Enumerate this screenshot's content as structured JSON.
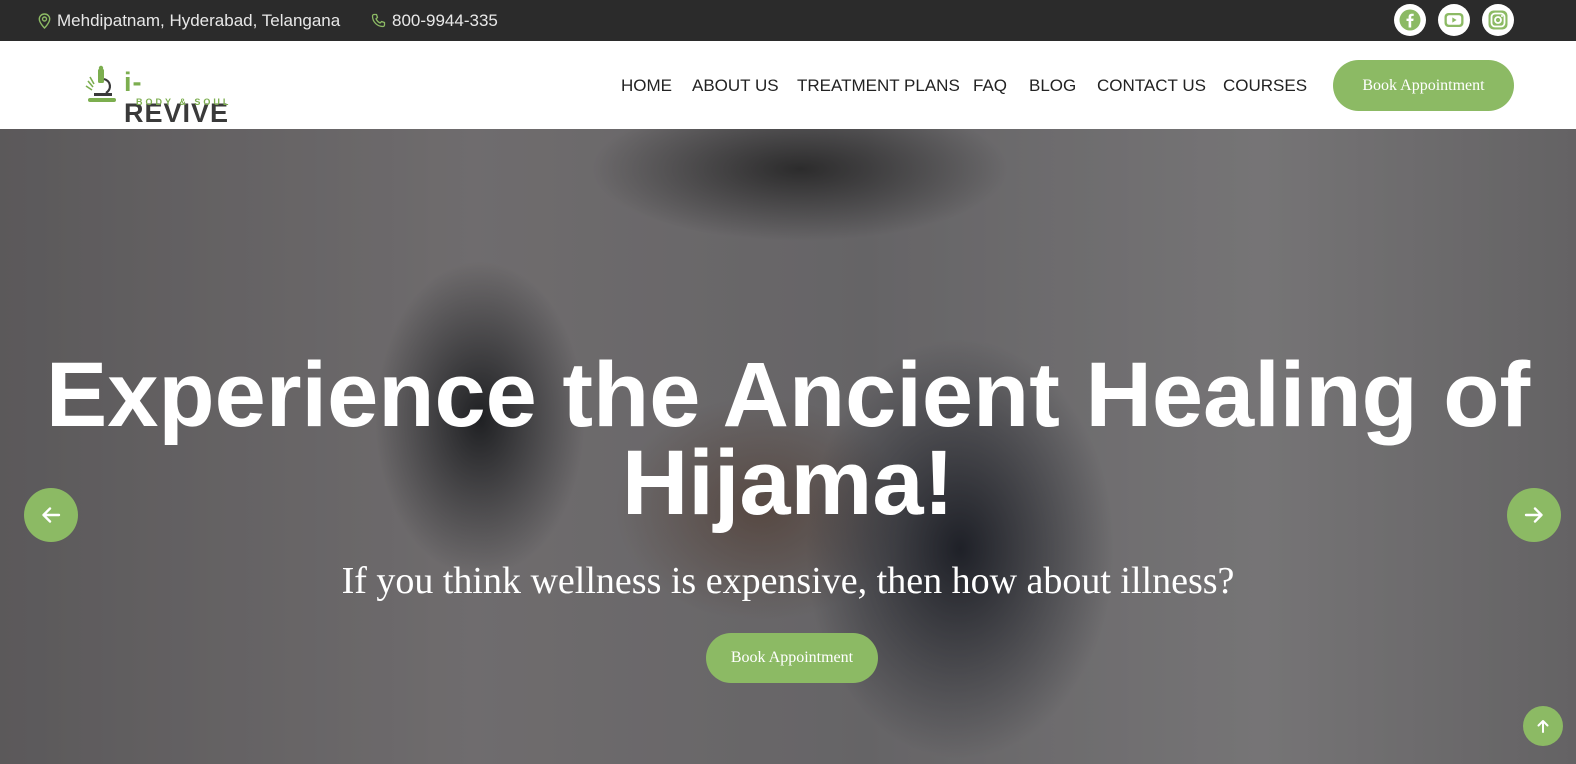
{
  "topbar": {
    "location": "Mehdipatnam, Hyderabad, Telangana",
    "phone": "800-9944-335",
    "socials": [
      {
        "icon": "facebook-icon"
      },
      {
        "icon": "youtube-icon"
      },
      {
        "icon": "instagram-icon"
      }
    ]
  },
  "brand": {
    "name_prefix": "i-",
    "name": "REVIVE",
    "tagline": "BODY & SOUL"
  },
  "nav": {
    "items": [
      "HOME",
      "ABOUT US",
      "TREATMENT PLANS",
      "FAQ",
      "BLOG",
      "CONTACT US",
      "COURSES"
    ],
    "book_label": "Book Appointment"
  },
  "hero": {
    "title": "Experience the Ancient Healing of Hijama!",
    "subtitle": "If you think wellness is expensive, then how about illness?",
    "book_label": "Book Appointment"
  },
  "colors": {
    "accent": "#8cba64",
    "topbar": "#2b2b2b"
  }
}
